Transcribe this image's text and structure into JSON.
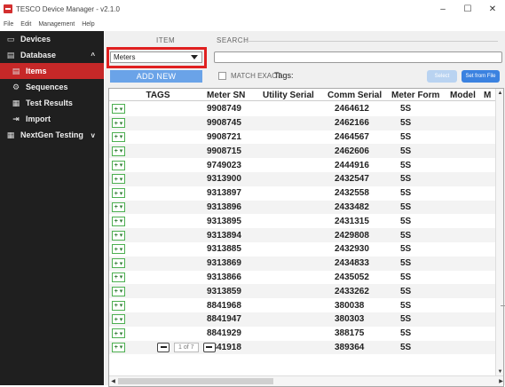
{
  "window": {
    "title": "TESCO Device Manager - v2.1.0",
    "controls": [
      "–",
      "☐",
      "✕"
    ]
  },
  "menu": [
    "File",
    "Edit",
    "Management",
    "Help"
  ],
  "sidebar": {
    "items": [
      {
        "label": "Devices",
        "icon": "devices-icon",
        "glyph": "▭"
      },
      {
        "label": "Database",
        "icon": "database-icon",
        "glyph": "▤",
        "chevron": "^"
      },
      {
        "label": "Items",
        "icon": "items-icon",
        "glyph": "▤",
        "active": true
      },
      {
        "label": "Sequences",
        "icon": "sequences-icon",
        "glyph": "⚙"
      },
      {
        "label": "Test Results",
        "icon": "test-results-icon",
        "glyph": "▦"
      },
      {
        "label": "Import",
        "icon": "import-icon",
        "glyph": "⇥"
      },
      {
        "label": "NextGen Testing",
        "icon": "nextgen-icon",
        "glyph": "▦",
        "chevron": "v"
      }
    ],
    "accent": "#c62828"
  },
  "toolbar": {
    "item_label": "ITEM",
    "search_label": "SEARCH",
    "item_value": "Meters",
    "add_new": "ADD NEW",
    "match_exact": "MATCH EXACT",
    "tags_label": "Tags:",
    "select_btn": "Select",
    "set_from_file": "Set from File",
    "search_value": ""
  },
  "table": {
    "columns": [
      "TAGS",
      "Meter SN",
      "Utility Serial",
      "Comm Serial",
      "Meter Form",
      "Model",
      "M"
    ],
    "tag_button": "+ ▾",
    "rows": [
      {
        "sn": "9908749",
        "util": "",
        "comm": "2464612",
        "form": "5S"
      },
      {
        "sn": "9908745",
        "util": "",
        "comm": "2462166",
        "form": "5S"
      },
      {
        "sn": "9908721",
        "util": "",
        "comm": "2464567",
        "form": "5S"
      },
      {
        "sn": "9908715",
        "util": "",
        "comm": "2462606",
        "form": "5S"
      },
      {
        "sn": "9749023",
        "util": "",
        "comm": "2444916",
        "form": "5S"
      },
      {
        "sn": "9313900",
        "util": "",
        "comm": "2432547",
        "form": "5S"
      },
      {
        "sn": "9313897",
        "util": "",
        "comm": "2432558",
        "form": "5S"
      },
      {
        "sn": "9313896",
        "util": "",
        "comm": "2433482",
        "form": "5S"
      },
      {
        "sn": "9313895",
        "util": "",
        "comm": "2431315",
        "form": "5S"
      },
      {
        "sn": "9313894",
        "util": "",
        "comm": "2429808",
        "form": "5S"
      },
      {
        "sn": "9313885",
        "util": "",
        "comm": "2432930",
        "form": "5S"
      },
      {
        "sn": "9313869",
        "util": "",
        "comm": "2434833",
        "form": "5S"
      },
      {
        "sn": "9313866",
        "util": "",
        "comm": "2435052",
        "form": "5S"
      },
      {
        "sn": "9313859",
        "util": "",
        "comm": "2433262",
        "form": "5S"
      },
      {
        "sn": "8841968",
        "util": "",
        "comm": "380038",
        "form": "5S"
      },
      {
        "sn": "8841947",
        "util": "",
        "comm": "380303",
        "form": "5S"
      },
      {
        "sn": "8841929",
        "util": "",
        "comm": "388175",
        "form": "5S"
      },
      {
        "sn": "8841918",
        "util": "",
        "comm": "389364",
        "form": "5S"
      }
    ]
  },
  "pager": {
    "current": "1",
    "text": "of 7"
  },
  "colors": {
    "highlight": "#e02020",
    "add_button": "#6aa3e8",
    "set_file": "#3b82e0"
  }
}
